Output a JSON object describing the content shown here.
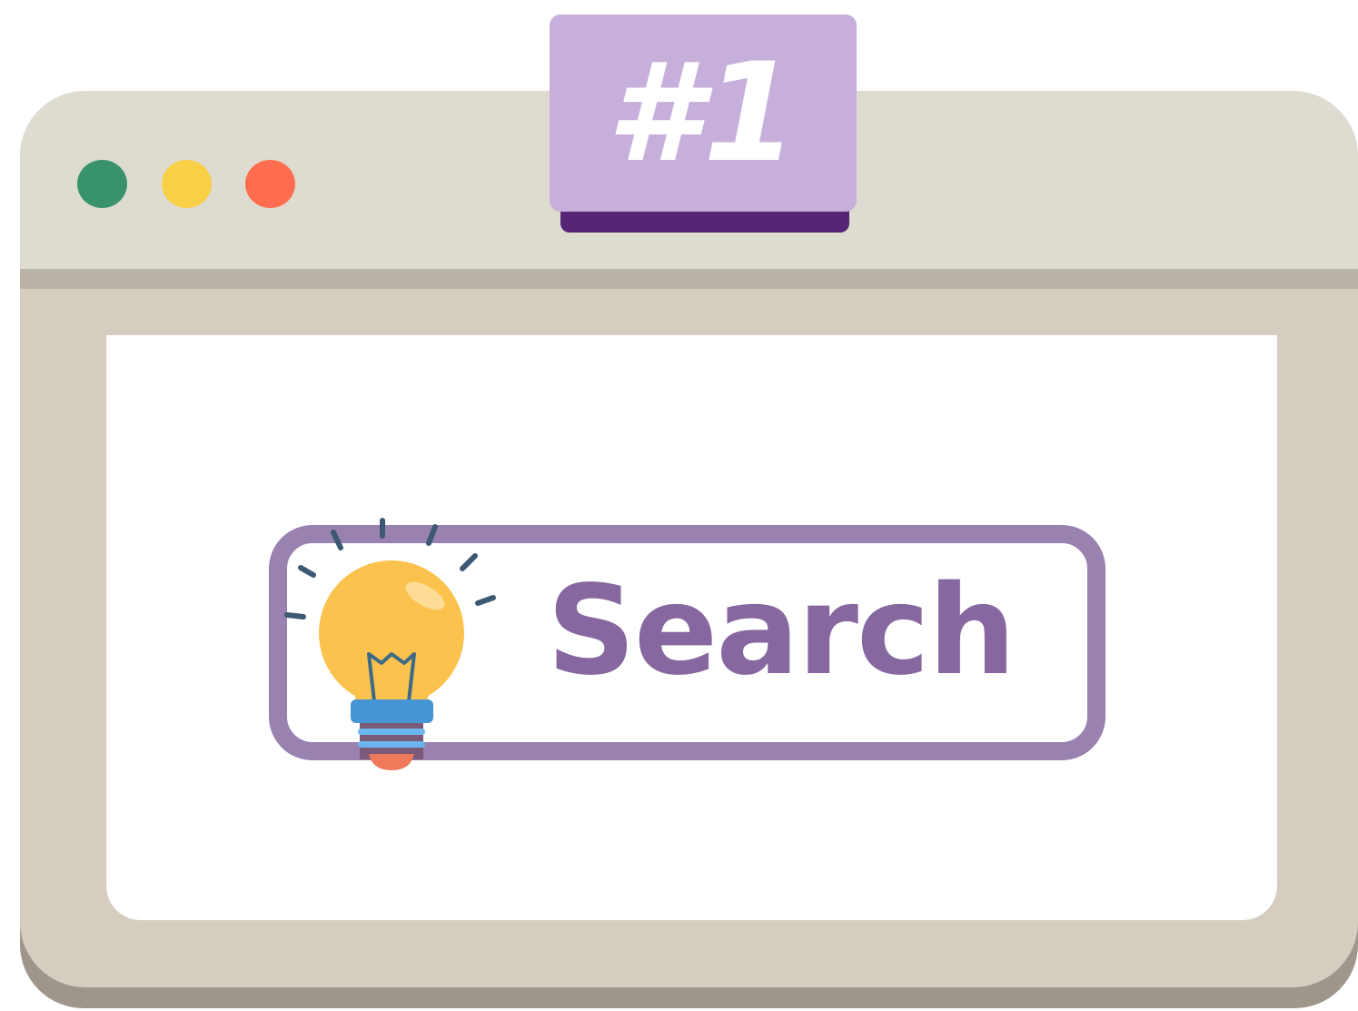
{
  "badge": {
    "label": "#1"
  },
  "window": {
    "controls": [
      {
        "name": "green",
        "color": "#38936b"
      },
      {
        "name": "yellow",
        "color": "#f7d046"
      },
      {
        "name": "red",
        "color": "#ff6d4e"
      }
    ]
  },
  "search": {
    "label": "Search",
    "icon": "lightbulb-icon",
    "border_color": "#9981b0",
    "text_color": "#8667a0"
  },
  "colors": {
    "titlebar": "#dedbd0",
    "frame": "#d4cdc0",
    "badge": "#c6b0db",
    "badge_shadow": "#552675"
  }
}
